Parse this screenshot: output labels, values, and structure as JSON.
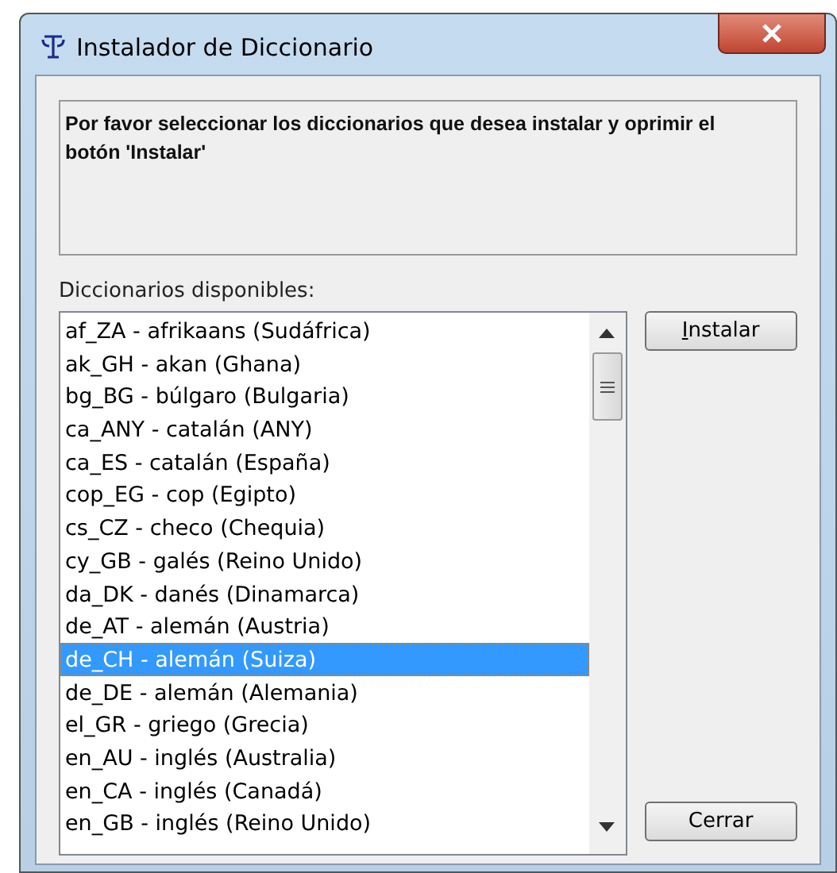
{
  "window": {
    "title": "Instalador de Diccionario"
  },
  "message": "Por favor seleccionar los diccionarios que desea instalar y oprimir el botón 'Instalar'",
  "list_label": "Diccionarios disponibles:",
  "dictionaries": [
    {
      "label": "af_ZA - afrikaans (Sudáfrica)",
      "selected": false
    },
    {
      "label": "ak_GH - akan (Ghana)",
      "selected": false
    },
    {
      "label": "bg_BG - búlgaro (Bulgaria)",
      "selected": false
    },
    {
      "label": "ca_ANY - catalán (ANY)",
      "selected": false
    },
    {
      "label": "ca_ES - catalán (España)",
      "selected": false
    },
    {
      "label": "cop_EG - cop (Egipto)",
      "selected": false
    },
    {
      "label": "cs_CZ - checo (Chequia)",
      "selected": false
    },
    {
      "label": "cy_GB - galés (Reino Unido)",
      "selected": false
    },
    {
      "label": "da_DK - danés (Dinamarca)",
      "selected": false
    },
    {
      "label": "de_AT - alemán (Austria)",
      "selected": false
    },
    {
      "label": "de_CH - alemán (Suiza)",
      "selected": true
    },
    {
      "label": "de_DE - alemán (Alemania)",
      "selected": false
    },
    {
      "label": "el_GR - griego (Grecia)",
      "selected": false
    },
    {
      "label": "en_AU - inglés (Australia)",
      "selected": false
    },
    {
      "label": "en_CA - inglés (Canadá)",
      "selected": false
    },
    {
      "label": "en_GB - inglés (Reino Unido)",
      "selected": false
    }
  ],
  "buttons": [
    {
      "label": "Instalar",
      "mnemonic_underlined": true
    },
    {
      "label": "Cerrar",
      "mnemonic_underlined": false
    }
  ]
}
